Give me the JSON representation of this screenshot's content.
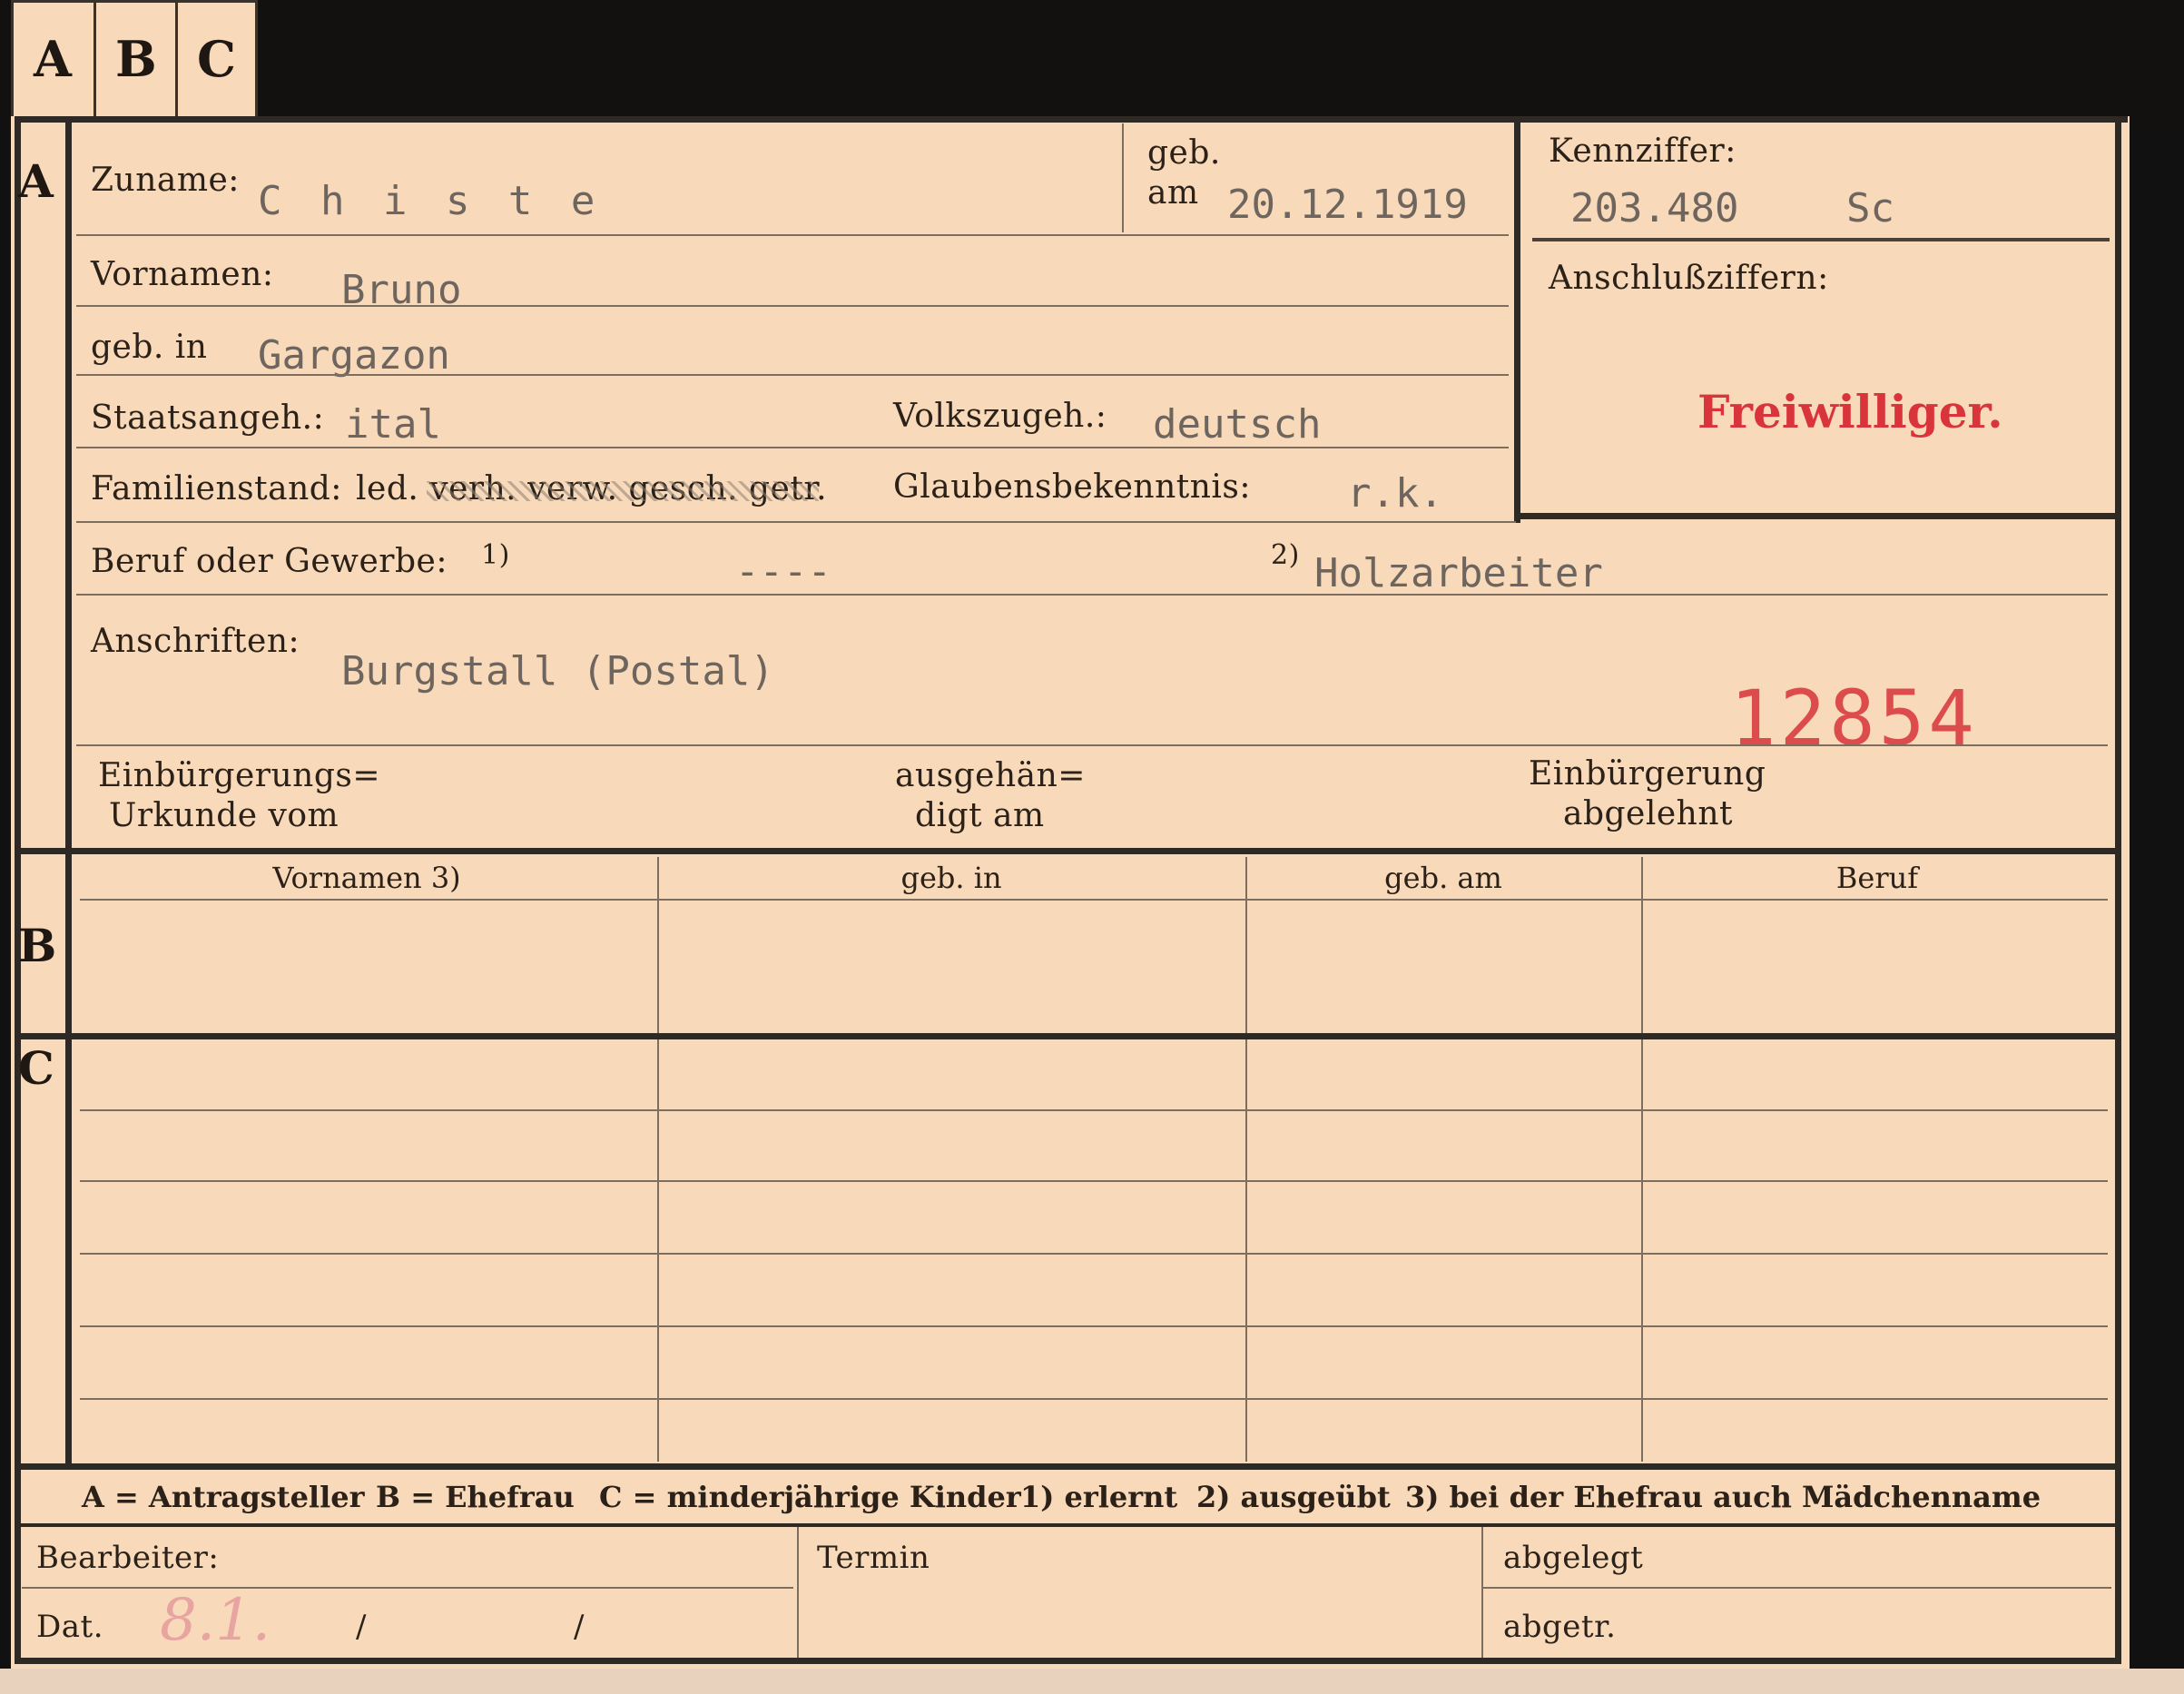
{
  "tabs": [
    "A",
    "B",
    "C"
  ],
  "sections": {
    "a": "A",
    "b": "B",
    "c": "C"
  },
  "fields": {
    "zuname_label": "Zuname:",
    "zuname_value": "C h i s t e",
    "geb_label": "geb.",
    "am_label": "am",
    "geb_am_value": "20.12.1919",
    "kennziffer_label": "Kennziffer:",
    "kennziffer_value": "203.480",
    "kennziffer_suffix": "Sc",
    "anschluss_label": "Anschlußziffern:",
    "stamp_freiwilliger": "Freiwilliger.",
    "vornamen_label": "Vornamen:",
    "vornamen_value": "Bruno",
    "geb_in_label": "geb. in",
    "geb_in_value": "Gargazon",
    "staats_label": "Staatsangeh.:",
    "staats_value": "ital",
    "volks_label": "Volkszugeh.:",
    "volks_value": "deutsch",
    "familien_label": "Familienstand:",
    "familien_options": "led. verh. verw. gesch. getr.",
    "glaubens_label": "Glaubensbekenntnis:",
    "glaubens_value": "r.k.",
    "beruf_label": "Beruf oder Gewerbe:",
    "beruf_note1": "1)",
    "beruf_value1": "----",
    "beruf_note2": "2)",
    "beruf_value2": "Holzarbeiter",
    "anschriften_label": "Anschriften:",
    "anschriften_value": "Burgstall (Postal)",
    "stamp_number": "12854",
    "einb_urkunde_l1": "Einbürgerungs=",
    "einb_urkunde_l2": "Urkunde vom",
    "ausgeh_l1": "ausgehän=",
    "ausgeh_l2": "digt am",
    "einb_abgelehnt_l1": "Einbürgerung",
    "einb_abgelehnt_l2": "abgelehnt"
  },
  "table": {
    "columns": [
      "Vornamen 3)",
      "geb. in",
      "geb. am",
      "Beruf"
    ]
  },
  "legend": {
    "a": "A = Antragsteller",
    "b": "B = Ehefrau",
    "c": "C = minderjährige Kinder",
    "n1": "1) erlernt",
    "n2": "2) ausgeübt",
    "n3": "3) bei der Ehefrau auch Mädchenname"
  },
  "footer": {
    "bearbeiter_label": "Bearbeiter:",
    "dat_label": "Dat.",
    "dat_slash1": "/",
    "dat_slash2": "/",
    "dat_handwritten": "8.1.",
    "termin_label": "Termin",
    "abgelegt_label": "abgelegt",
    "abgetr_label": "abgetr."
  },
  "colors": {
    "paper": "#f8d9b9",
    "stamp_red": "#d9343b",
    "ink_frame": "#2e2923"
  }
}
